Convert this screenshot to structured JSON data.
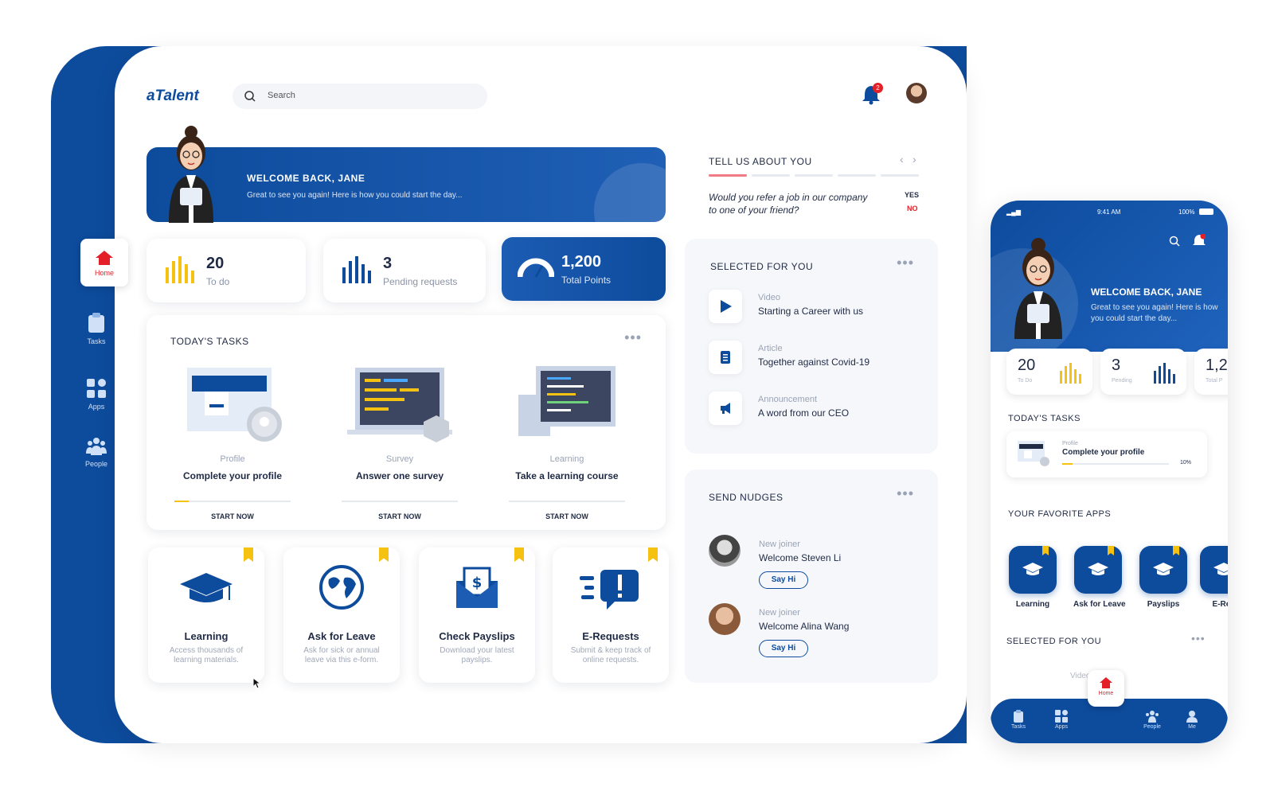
{
  "app": {
    "logo": "aTalent",
    "search_placeholder": "Search",
    "notification_count": "2"
  },
  "sidebar": {
    "items": [
      {
        "label": "Home",
        "icon": "home-icon"
      },
      {
        "label": "Tasks",
        "icon": "clipboard-icon"
      },
      {
        "label": "Apps",
        "icon": "apps-icon"
      },
      {
        "label": "People",
        "icon": "people-icon"
      }
    ]
  },
  "welcome": {
    "title": "WELCOME BACK, JANE",
    "subtitle": "Great to see you again! Here is how you could start the day..."
  },
  "stats": [
    {
      "value": "20",
      "label": "To do"
    },
    {
      "value": "3",
      "label": "Pending requests"
    },
    {
      "value": "1,200",
      "label": "Total Points"
    }
  ],
  "tasks": {
    "title": "TODAY'S TASKS",
    "items": [
      {
        "category": "Profile",
        "title": "Complete your profile",
        "button": "START NOW",
        "progress": 0.12
      },
      {
        "category": "Survey",
        "title": "Answer one survey",
        "button": "START NOW",
        "progress": 0
      },
      {
        "category": "Learning",
        "title": "Take a learning course",
        "button": "START NOW",
        "progress": 0
      }
    ]
  },
  "apps": [
    {
      "title": "Learning",
      "desc": "Access thousands of learning materials."
    },
    {
      "title": "Ask for Leave",
      "desc": "Ask for sick or annual leave via this e-form."
    },
    {
      "title": "Check Payslips",
      "desc": "Download your latest payslips."
    },
    {
      "title": "E-Requests",
      "desc": "Submit & keep track of online requests."
    }
  ],
  "survey": {
    "title": "TELL US ABOUT YOU",
    "question": "Would you refer a job in our company to one of your friend?",
    "yes": "YES",
    "no": "NO"
  },
  "selected": {
    "title": "SELECTED FOR YOU",
    "items": [
      {
        "type": "Video",
        "title": "Starting a Career with us"
      },
      {
        "type": "Article",
        "title": "Together against Covid-19"
      },
      {
        "type": "Announcement",
        "title": "A word from our CEO"
      }
    ]
  },
  "nudges": {
    "title": "SEND NUDGES",
    "items": [
      {
        "type": "New joiner",
        "name": "Welcome Steven Li",
        "button": "Say Hi"
      },
      {
        "type": "New joiner",
        "name": "Welcome Alina Wang",
        "button": "Say Hi"
      }
    ]
  },
  "mobile": {
    "time": "9:41 AM",
    "battery": "100%",
    "welcome_title": "WELCOME BACK, JANE",
    "welcome_sub": "Great to see you again! Here is how you could start the day...",
    "stats": [
      {
        "value": "20",
        "label": "To Do"
      },
      {
        "value": "3",
        "label": "Pending"
      },
      {
        "value": "1,2",
        "label": "Total P"
      }
    ],
    "tasks_title": "TODAY'S TASKS",
    "task": {
      "category": "Profile",
      "title": "Complete your profile",
      "progress": "10%"
    },
    "apps_title": "YOUR FAVORITE APPS",
    "apps": [
      "Learning",
      "Ask for Leave",
      "Payslips",
      "E-Req"
    ],
    "selected_title": "SELECTED FOR YOU",
    "selected_peek": "Video",
    "nav": [
      "Tasks",
      "Apps",
      "Home",
      "People",
      "Me"
    ]
  }
}
